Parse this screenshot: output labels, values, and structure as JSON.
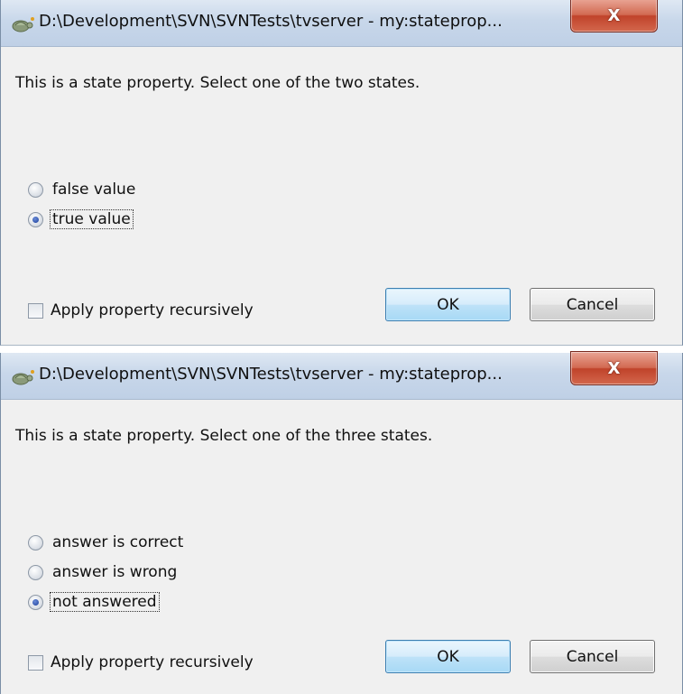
{
  "dialogs": [
    {
      "title": "D:\\Development\\SVN\\SVNTests\\tvserver - my:stateprop...",
      "message": "This is a state property. Select one of the two states.",
      "options": [
        {
          "label": "false value",
          "checked": false
        },
        {
          "label": "true value",
          "checked": true
        }
      ],
      "recursive_label": "Apply property recursively",
      "ok_label": "OK",
      "cancel_label": "Cancel",
      "close_glyph": "X"
    },
    {
      "title": "D:\\Development\\SVN\\SVNTests\\tvserver - my:stateprop...",
      "message": "This is a state property. Select one of the three states.",
      "options": [
        {
          "label": "answer is correct",
          "checked": false
        },
        {
          "label": "answer is wrong",
          "checked": false
        },
        {
          "label": "not answered",
          "checked": true
        }
      ],
      "recursive_label": "Apply property recursively",
      "ok_label": "OK",
      "cancel_label": "Cancel",
      "close_glyph": "X"
    }
  ],
  "icons": {
    "app": "tortoisesvn-icon",
    "close": "close-icon"
  },
  "colors": {
    "dialog_bg": "#f0f0f0",
    "titlebar": "#c8d7ea",
    "close_button": "#c0432a",
    "ok_border": "#3c7fb1"
  }
}
